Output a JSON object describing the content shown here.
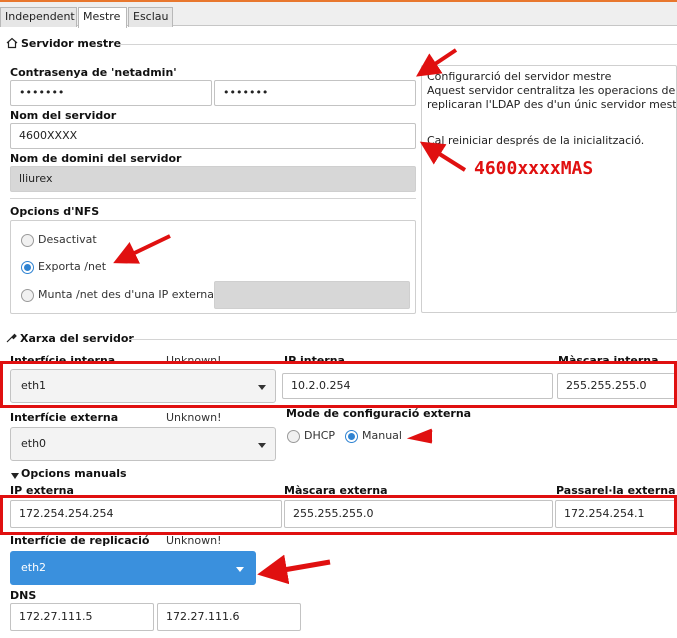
{
  "tabs": [
    {
      "label": "Independent"
    },
    {
      "label": "Mestre"
    },
    {
      "label": "Esclau"
    }
  ],
  "master": {
    "section_title": "Servidor mestre",
    "password_label": "Contrasenya de 'netadmin'",
    "password_value": "•••••••",
    "password_confirm_value": "•••••••",
    "server_name_label": "Nom del servidor",
    "server_name_value": "4600XXXX",
    "domain_label": "Nom de domini del servidor",
    "domain_value": "lliurex",
    "nfs_label": "Opcions d'NFS",
    "nfs_options": [
      "Desactivat",
      "Exporta /net",
      "Munta /net des d'una IP externa"
    ],
    "nfs_selected": "Exporta /net"
  },
  "info_panel": {
    "line1": "Configurarció del servidor mestre",
    "line2": "Aquest servidor centralitza les operacions de l",
    "line3": "replicaran l'LDAP des d'un únic servidor mestre",
    "line4": "Cal reiniciar després de la inicialització."
  },
  "annotation": {
    "text": "4600xxxxMAS",
    "color": "#e01010"
  },
  "network": {
    "section_title": "Xarxa del servidor",
    "internal_iface_label": "Interfície interna",
    "internal_iface_status": "Unknown!",
    "internal_iface_value": "eth1",
    "internal_ip_label": "IP interna",
    "internal_ip_value": "10.2.0.254",
    "internal_mask_label": "Màscara interna",
    "internal_mask_value": "255.255.255.0",
    "external_iface_label": "Interfície externa",
    "external_iface_status": "Unknown!",
    "external_iface_value": "eth0",
    "external_mode_label": "Mode de configuració externa",
    "mode_dhcp": "DHCP",
    "mode_manual": "Manual",
    "manual_section_label": "Opcions manuals",
    "external_ip_label": "IP externa",
    "external_ip_value": "172.254.254.254",
    "external_mask_label": "Màscara externa",
    "external_mask_value": "255.255.255.0",
    "gateway_label": "Passarel·la externa",
    "gateway_value": "172.254.254.1",
    "replication_label": "Interfície de replicació",
    "replication_status": "Unknown!",
    "replication_value": "eth2",
    "dns_label": "DNS",
    "dns1": "172.27.111.5",
    "dns2": "172.27.111.6"
  }
}
